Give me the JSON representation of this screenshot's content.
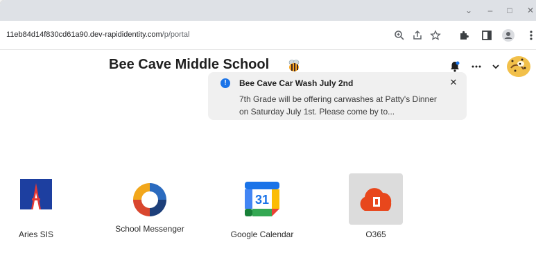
{
  "browser": {
    "url_host": "11eb84d14f830cd61a90.dev-rapididentity.com",
    "url_path": "/p/portal"
  },
  "header": {
    "school_name": "Bee Cave Middle School"
  },
  "notification": {
    "title": "Bee Cave Car Wash July 2nd",
    "body": "7th Grade will be offering carwashes at Patty's Dinner on Saturday July 1st. Please come by to..."
  },
  "apps": [
    {
      "label": "Aries SIS"
    },
    {
      "label": "School Messenger"
    },
    {
      "label": "Google Calendar"
    },
    {
      "label": "O365"
    }
  ],
  "colors": {
    "accent_blue": "#1a73e8",
    "aries_blue": "#1d3fa0",
    "aries_red": "#e53935",
    "o365_red": "#e8471c"
  },
  "icons": [
    "zoom-icon",
    "share-icon",
    "star-icon",
    "extensions-icon",
    "sidepanel-icon",
    "profile-icon",
    "kebab-menu-icon",
    "bell-icon",
    "more-icon",
    "chevron-down-icon",
    "mascot-avatar"
  ]
}
